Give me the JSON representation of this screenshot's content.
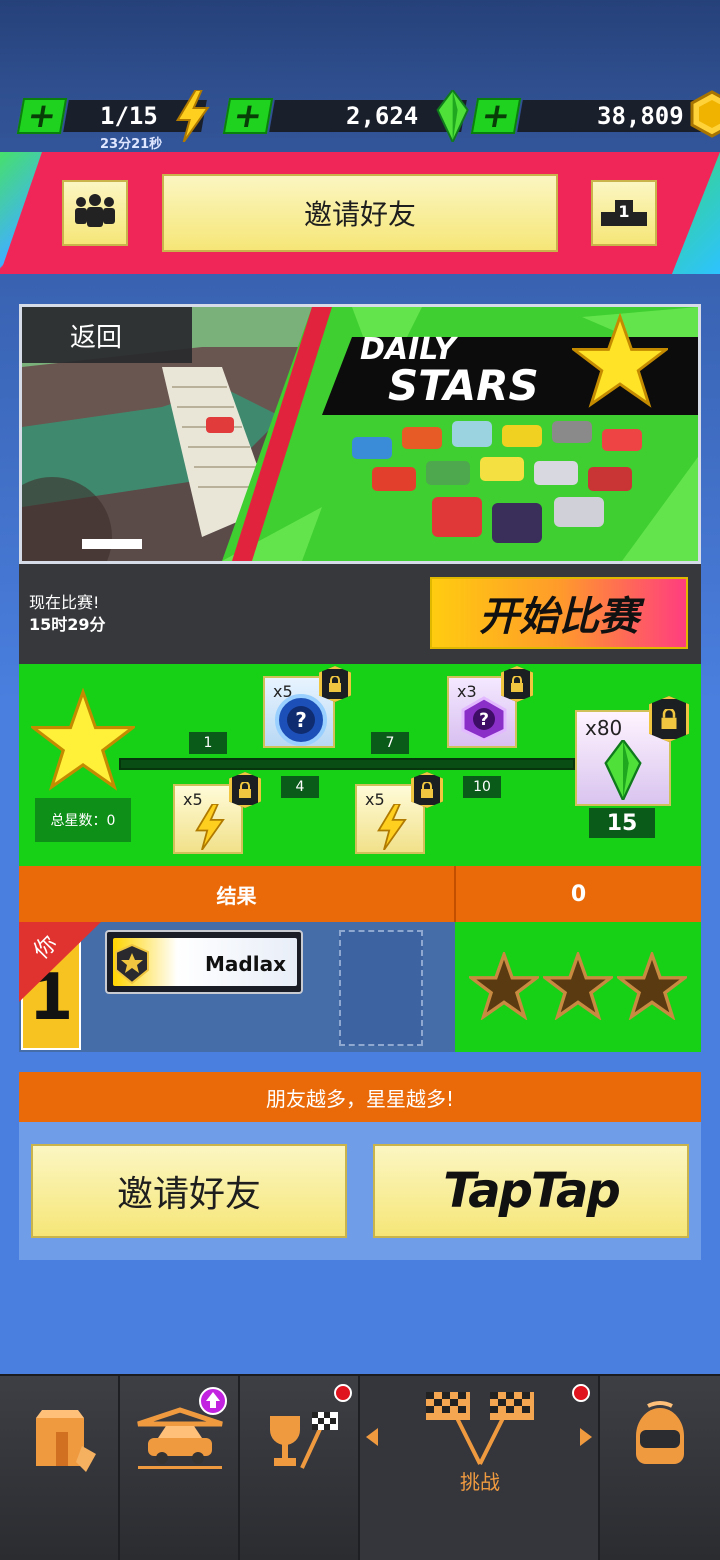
{
  "currency": {
    "energy": {
      "value": "1/15",
      "timer": "23分21秒"
    },
    "gems": {
      "value": "2,624"
    },
    "coins": {
      "value": "38,809"
    }
  },
  "banner": {
    "invite_label": "邀请好友",
    "leaderboard_rank": "1"
  },
  "event": {
    "back_label": "返回",
    "title_line1": "DAILY",
    "title_line2": "STARS",
    "status_label": "现在比赛!",
    "time_left": "15时29分",
    "start_label": "开始比赛"
  },
  "rewards": {
    "total_label": "总星数：0",
    "milestones": [
      "1",
      "4",
      "7",
      "10",
      "15"
    ],
    "items": [
      {
        "count": "x5",
        "type": "energy"
      },
      {
        "count": "x5",
        "type": "mystery-box-blue"
      },
      {
        "count": "x5",
        "type": "energy"
      },
      {
        "count": "x3",
        "type": "mystery-box-purple"
      },
      {
        "count": "x80",
        "type": "gem"
      }
    ]
  },
  "results": {
    "header": "结果",
    "score": "0",
    "you_label": "你",
    "rank": "1",
    "player_name": "Madlax"
  },
  "promo": {
    "header": "朋友越多，星星越多!",
    "invite_label": "邀请好友",
    "taptap_label": "TapTap"
  },
  "nav": {
    "challenge_label": "挑战"
  },
  "colors": {
    "green": "#17d117",
    "orange": "#ea6a0a",
    "pink": "#f02659",
    "yellow": "#f6e678"
  }
}
